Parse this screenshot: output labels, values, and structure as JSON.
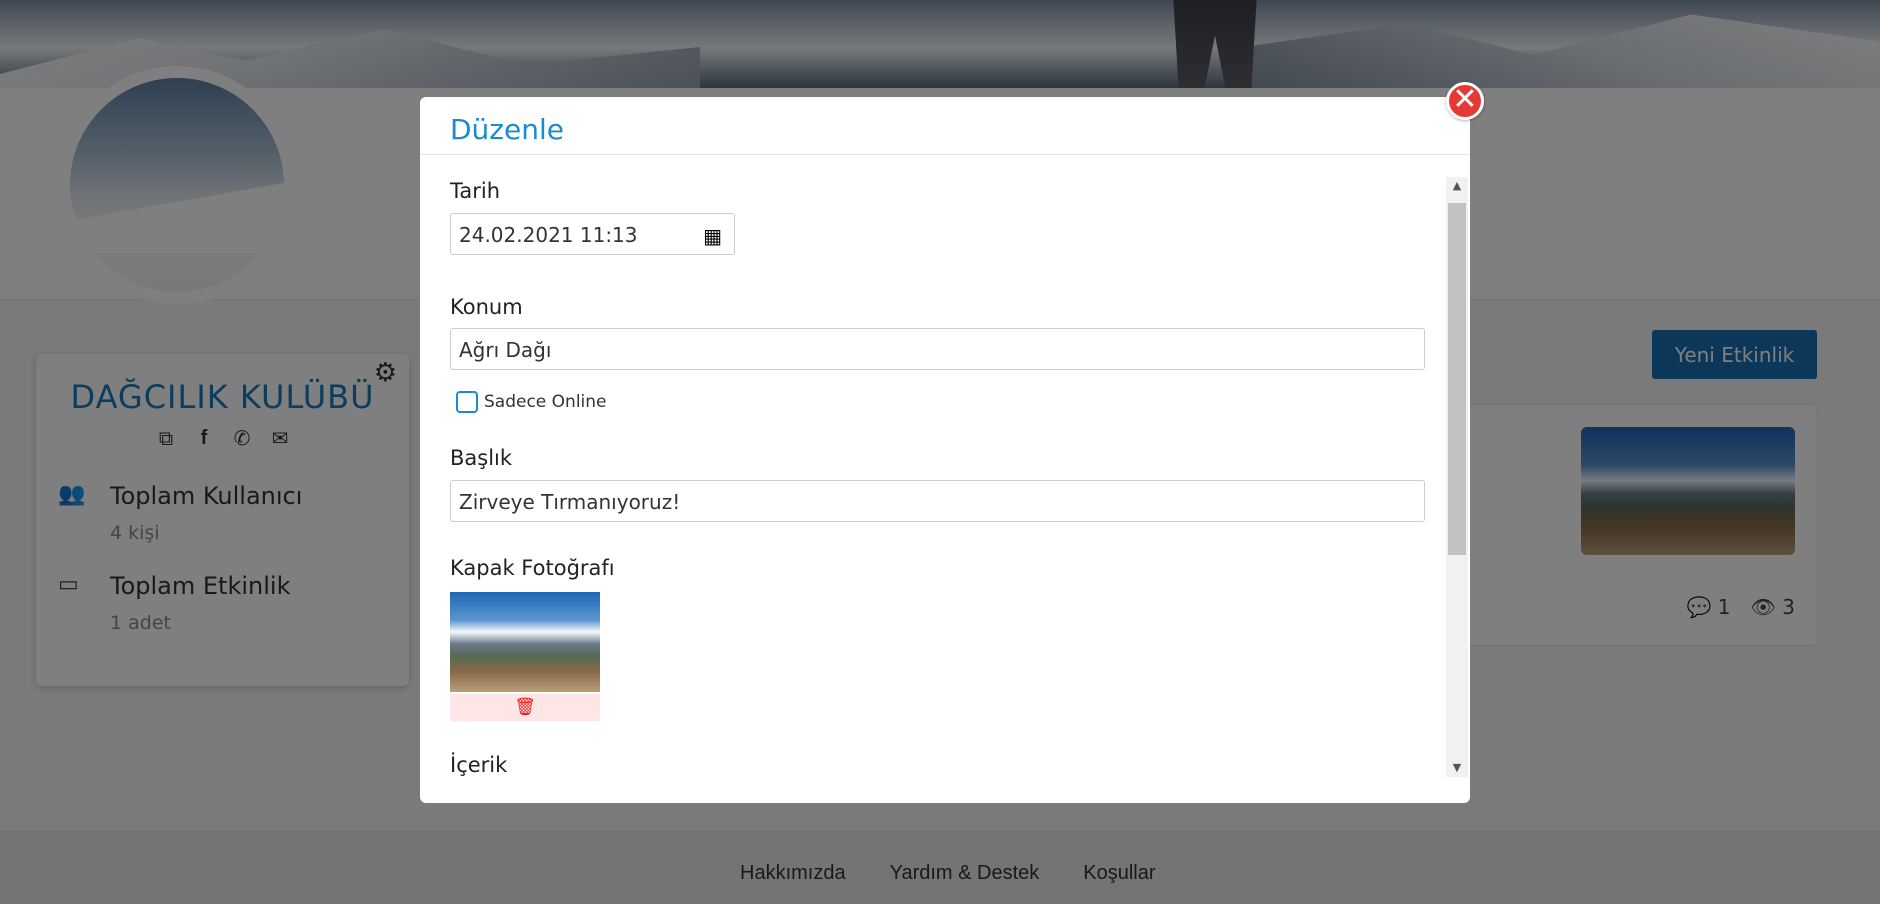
{
  "club": {
    "name": "DAĞCILIK KULÜBÜ",
    "stats": [
      {
        "label": "Toplam Kullanıcı",
        "value": "4 kişi"
      },
      {
        "label": "Toplam Etkinlik",
        "value": "1 adet"
      }
    ],
    "links": [
      "external-link-icon",
      "facebook-icon",
      "phone-icon",
      "envelope-icon"
    ]
  },
  "events": {
    "new_button": "Yeni Etkinlik",
    "card": {
      "comments": "1",
      "views": "3"
    }
  },
  "footer": {
    "links": [
      "Hakkımızda",
      "Yardım & Destek",
      "Koşullar"
    ]
  },
  "modal": {
    "title": "Düzenle",
    "close_symbol": "✕",
    "date": {
      "label": "Tarih",
      "value": "24.02.2021 11:13"
    },
    "location": {
      "label": "Konum",
      "value": "Ağrı Dağı"
    },
    "online_only": {
      "label": "Sadece Online",
      "checked": false
    },
    "heading": {
      "label": "Başlık",
      "value": "Zirveye Tırmanıyoruz!"
    },
    "cover": {
      "label": "Kapak Fotoğrafı"
    },
    "content": {
      "label": "İçerik"
    }
  },
  "colors": {
    "accent": "#1b8bd1",
    "primary_button": "#1a6fb0",
    "close": "#e53935",
    "delete": "#e81717"
  }
}
